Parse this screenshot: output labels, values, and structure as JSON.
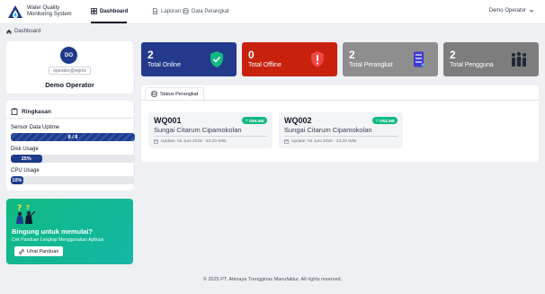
{
  "brand": {
    "line1": "Water Quality",
    "line2": "Monitoring System"
  },
  "nav": {
    "items": [
      {
        "label": "Dashboard",
        "icon": "dashboard-icon",
        "active": true
      },
      {
        "label": "Laporan",
        "icon": "document-icon",
        "active": false
      },
      {
        "label": "Data Perangkat",
        "icon": "database-icon",
        "active": false
      }
    ],
    "user_label": "Demo Operator"
  },
  "breadcrumb": {
    "label": "Dashboard"
  },
  "profile": {
    "initials": "DO",
    "email": "operator@wqms",
    "name": "Demo Operator"
  },
  "summary": {
    "title": "Ringkasan",
    "metrics": [
      {
        "label": "Sensor Data Uptime",
        "value_text": "8 / 8",
        "fraction": 1.0
      },
      {
        "label": "Disk Usage",
        "value_text": "25%",
        "fraction": 0.25
      },
      {
        "label": "CPU Usage",
        "value_text": "10%",
        "fraction": 0.1
      }
    ]
  },
  "help": {
    "title": "Bingung untuk memulai?",
    "subtitle": "Cek Panduan Lengkap Menggunakan Aplikasi",
    "button_label": "Lihat Panduan"
  },
  "stats": [
    {
      "value": "2",
      "label": "Total Online",
      "color": "#233a8c",
      "icon": "shield-check-icon"
    },
    {
      "value": "0",
      "label": "Total Offline",
      "color": "#c8220f",
      "icon": "alert-shield-icon"
    },
    {
      "value": "2",
      "label": "Total Perangkat",
      "color": "#8e8e8e",
      "icon": "server-icon"
    },
    {
      "value": "2",
      "label": "Total Pengguna",
      "color": "#7d7d7d",
      "icon": "users-icon"
    }
  ],
  "status_panel": {
    "tab_label": "Status Perangkat",
    "devices": [
      {
        "id": "WQ001",
        "status": "ONLINE",
        "location": "Sungai Citarum Cipamokolan",
        "updated": "Update: 04 Juni 2025 - 23:20 WIB"
      },
      {
        "id": "WQ002",
        "status": "ONLINE",
        "location": "Sungai Citarum Cipamokolan",
        "updated": "Update: 04 Juni 2025 - 23:20 WIB"
      }
    ]
  },
  "footer": {
    "text": "© 2025 PT. Abinaya Trengginas Manufaktur. All rights reserved."
  },
  "colors": {
    "primary": "#1e3a8a",
    "online": "#10b981",
    "help_gradient_start": "#10b981",
    "help_gradient_end": "#14b8a6"
  }
}
